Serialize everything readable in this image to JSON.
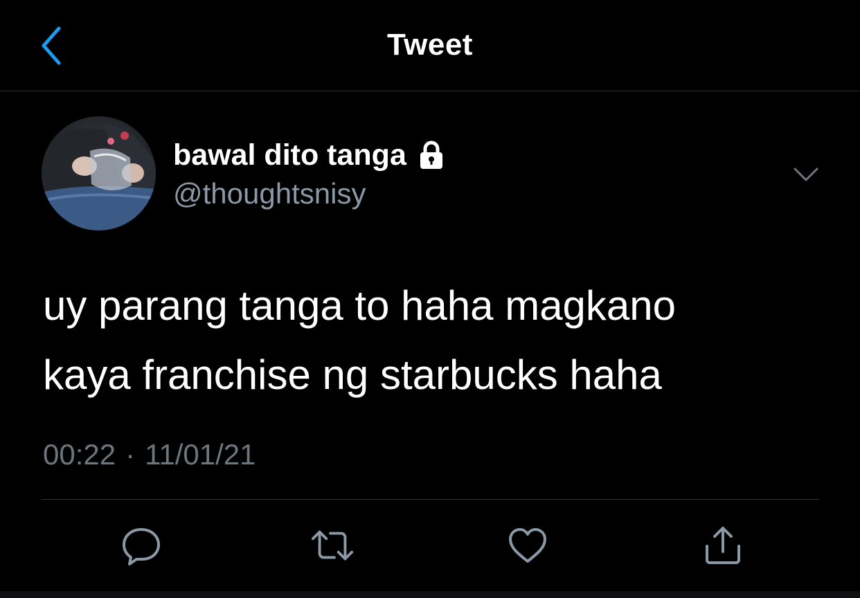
{
  "header": {
    "title": "Tweet",
    "back_icon": "chevron-left-icon"
  },
  "author": {
    "display_name": "bawal dito tanga",
    "handle": "@thoughtsnisy",
    "protected_icon": "lock-icon",
    "more_icon": "chevron-down-icon"
  },
  "tweet": {
    "text": "uy parang tanga to haha magkano\nkaya franchise ng starbucks haha",
    "time": "00:22",
    "separator": "·",
    "date": "11/01/21"
  },
  "actions": [
    {
      "name": "reply",
      "icon": "reply-icon"
    },
    {
      "name": "retweet",
      "icon": "retweet-icon"
    },
    {
      "name": "like",
      "icon": "heart-icon"
    },
    {
      "name": "share",
      "icon": "share-icon"
    }
  ],
  "colors": {
    "background": "#000000",
    "accent": "#1d9bf0",
    "secondary_text": "#8b98a5",
    "meta_text": "#6e767d",
    "icon": "#8b98a5",
    "divider": "#2f3336"
  }
}
